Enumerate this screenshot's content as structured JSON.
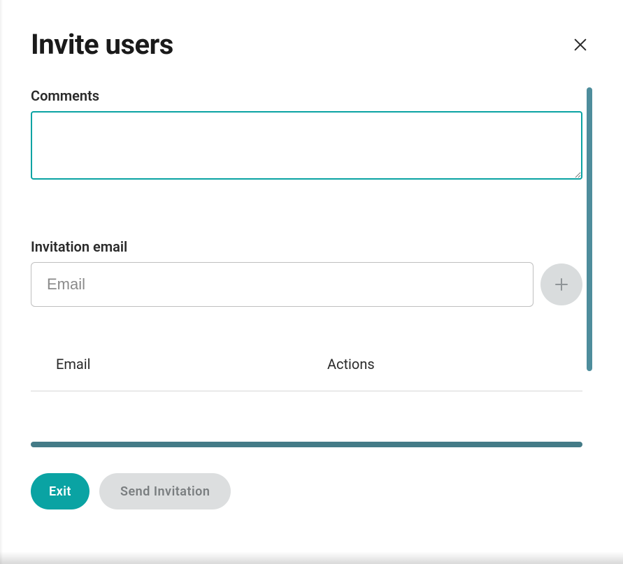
{
  "header": {
    "title": "Invite users"
  },
  "fields": {
    "comments_label": "Comments",
    "comments_value": "",
    "invitation_label": "Invitation email",
    "email_placeholder": "Email",
    "email_value": ""
  },
  "table": {
    "columns": {
      "email": "Email",
      "actions": "Actions"
    },
    "rows": []
  },
  "footer": {
    "exit_label": "Exit",
    "send_label": "Send Invitation"
  },
  "colors": {
    "accent": "#0aa3a3",
    "scrollbar": "#4e8d9c"
  }
}
